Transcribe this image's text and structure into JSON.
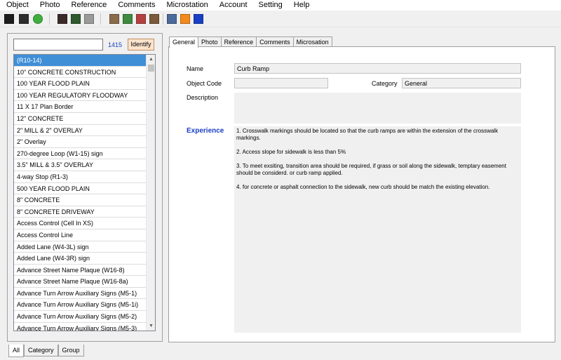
{
  "menu": [
    "Object",
    "Photo",
    "Reference",
    "Comments",
    "Microstation",
    "Account",
    "Setting",
    "Help"
  ],
  "toolbar": {
    "buttons": [
      {
        "icon": "dark-box-icon",
        "color": "#1e1e1e"
      },
      {
        "icon": "dark-panel-icon",
        "color": "#2e2e2e"
      },
      {
        "icon": "green-circle-icon",
        "color": "#3fae3f"
      },
      {
        "icon": "camera-icon",
        "color": "#3a2a2a"
      },
      {
        "icon": "photo-thumbnail-icon",
        "color": "#2e5a2e"
      },
      {
        "icon": "capture-icon",
        "color": "#9a9a9a"
      },
      {
        "icon": "tool-icon",
        "color": "#8a6b4a"
      },
      {
        "icon": "plant-icon",
        "color": "#3f8a3f"
      },
      {
        "icon": "marker-icon",
        "color": "#b54040"
      },
      {
        "icon": "pen-icon",
        "color": "#7a5a3a"
      },
      {
        "icon": "landscape-image-icon",
        "color": "#4a6a9a"
      },
      {
        "icon": "rss-icon",
        "color": "#f28a1e"
      },
      {
        "icon": "arrow-right-icon",
        "color": "#1a3fc4"
      }
    ]
  },
  "search": {
    "value": "",
    "count": "1415",
    "identify_label": "Identify"
  },
  "list": {
    "items": [
      "(R10-14)",
      "10\" CONCRETE CONSTRUCTION",
      "100 YEAR FLOOD PLAIN",
      "100 YEAR REGULATORY FLOODWAY",
      "11 X 17 Plan Border",
      "12\" CONCRETE",
      "2\" MILL & 2\" OVERLAY",
      "2\" Overlay",
      "270-degree Loop (W1-15) sign",
      "3.5\" MILL & 3.5\" OVERLAY",
      "4-way Stop (R1-3)",
      "500 YEAR FLOOD PLAIN",
      "8\" CONCRETE",
      "8\" CONCRETE DRIVEWAY",
      "Access Control (Cell In XS)",
      "Access Control Line",
      "Added Lane (W4-3L) sign",
      "Added Lane (W4-3R) sign",
      "Advance Street Name Plaque (W16-8)",
      "Advance Street Name Plaque (W16-8a)",
      "Advance Turn Arrow Auxiliary Signs (M5-1)",
      "Advance Turn Arrow Auxiliary Signs (M5-1i)",
      "Advance Turn Arrow Auxiliary Signs (M5-2)",
      "Advance Turn Arrow Auxiliary Signs (M5-3)"
    ]
  },
  "bottom_tabs": [
    "All",
    "Category",
    "Group"
  ],
  "detail_tabs": [
    "General",
    "Photo",
    "Reference",
    "Comments",
    "Microsation"
  ],
  "general": {
    "name_label": "Name",
    "name_value": "Curb Ramp",
    "object_code_label": "Object Code",
    "object_code_value": "",
    "category_label": "Category",
    "category_value": "General",
    "description_label": "Description",
    "description_value": "",
    "experience_label": "Experience",
    "experience": [
      "1. Crosswalk markings should be located so that the curb ramps are within the extension of the crosswalk markings.",
      "2. Access slope for sidewalk is less than 5%",
      "3. To meet exsiting, transition area should be required, if grass or soil along the sidewalk, temptary easement should be considerd. or curb ramp applied.",
      "4. for concrete or asphalt connection to the sidewalk, new curb should be match the existing elevation."
    ]
  },
  "colors": {
    "selected": "#3f8fd7",
    "link_blue": "#1a3fc4",
    "identify_bg": "#fbe3cc"
  }
}
